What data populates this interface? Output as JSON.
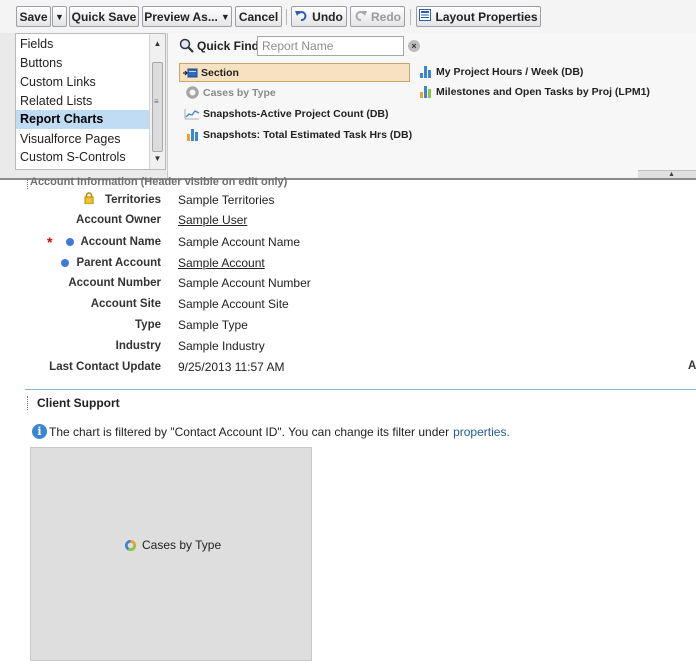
{
  "toolbar": {
    "save": "Save",
    "quick_save": "Quick Save",
    "preview_as": "Preview As...",
    "cancel": "Cancel",
    "undo": "Undo",
    "redo": "Redo",
    "layout_properties": "Layout Properties"
  },
  "palette": {
    "categories": [
      {
        "label": "Fields"
      },
      {
        "label": "Buttons"
      },
      {
        "label": "Custom Links"
      },
      {
        "label": "Related Lists"
      },
      {
        "label": "Report Charts",
        "active": true
      },
      {
        "label": "Visualforce Pages"
      },
      {
        "label": "Custom S-Controls"
      }
    ],
    "quick_find": {
      "label": "Quick Find",
      "placeholder": "Report Name"
    },
    "items": {
      "section": "Section",
      "cases_by_type": "Cases by Type",
      "snapshots_active_project_count": "Snapshots-Active Project Count (DB)",
      "snapshots_total_estimated_task_hrs": "Snapshots: Total Estimated Task Hrs (DB)",
      "my_project_hours_week": "My Project Hours / Week (DB)",
      "milestones_open_tasks": "Milestones and Open Tasks by Proj (LPM1)"
    }
  },
  "layout": {
    "clipped_section_header": "Account Information (Header visible on edit only)",
    "fields": [
      {
        "label": "Territories",
        "value": "Sample Territories"
      },
      {
        "label": "Account Owner",
        "value": "Sample User"
      },
      {
        "label": "Account Name",
        "value": "Sample Account Name"
      },
      {
        "label": "Parent Account",
        "value": "Sample Account"
      },
      {
        "label": "Account Number",
        "value": "Sample Account Number"
      },
      {
        "label": "Account Site",
        "value": "Sample Account Site"
      },
      {
        "label": "Type",
        "value": "Sample Type"
      },
      {
        "label": "Industry",
        "value": "Sample Industry"
      },
      {
        "label": "Last Contact Update",
        "value": "9/25/2013 11:57 AM"
      }
    ],
    "right_column_label": "A",
    "client_support": {
      "title": "Client Support",
      "info_text": "The chart is filtered by \"Contact Account ID\". You can change its filter under",
      "info_link": "properties.",
      "chart_label": "Cases by Type"
    }
  }
}
